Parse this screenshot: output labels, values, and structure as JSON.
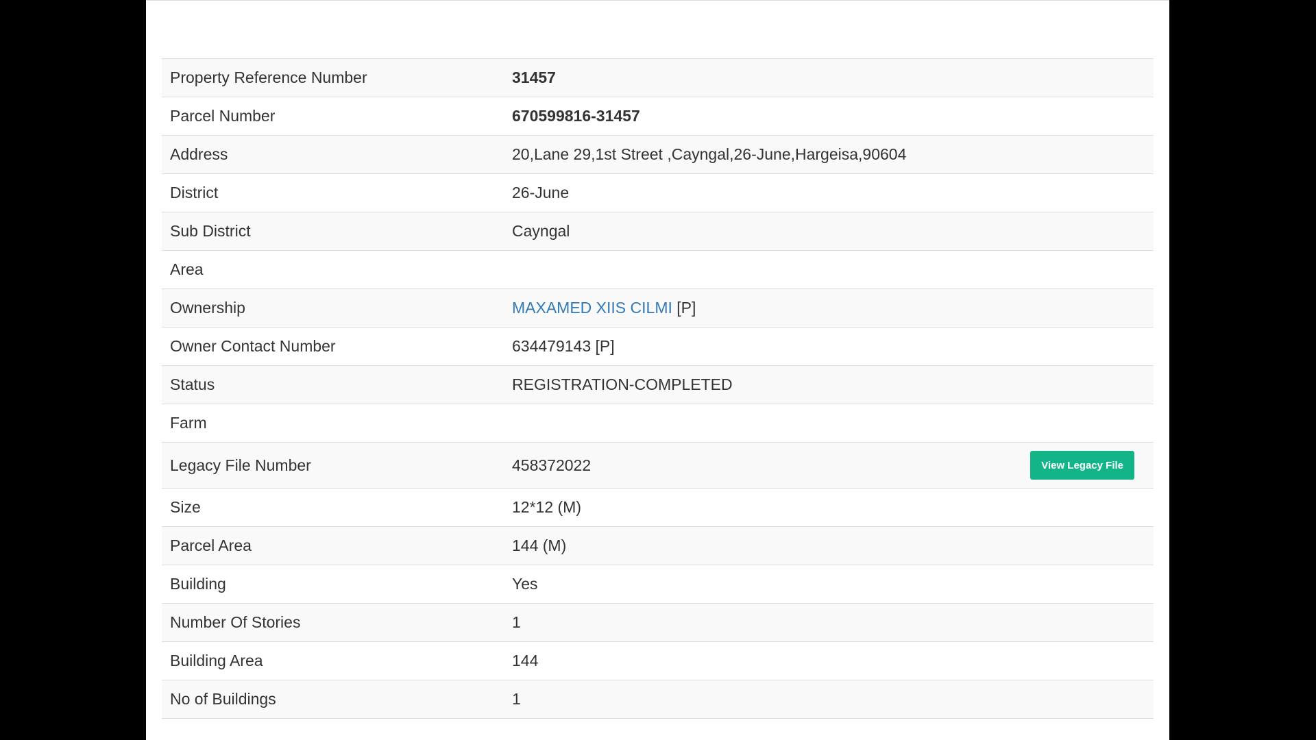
{
  "rows": [
    {
      "label": "Property Reference Number",
      "value": "31457"
    },
    {
      "label": "Parcel Number",
      "value": "670599816-31457"
    },
    {
      "label": "Address",
      "value": "20,Lane 29,1st Street ,Cayngal,26-June,Hargeisa,90604"
    },
    {
      "label": "District",
      "value": "26-June"
    },
    {
      "label": "Sub District",
      "value": "Cayngal"
    },
    {
      "label": "Area",
      "value": ""
    },
    {
      "label": "Ownership",
      "value": "MAXAMED XIIS CILMI",
      "suffix": "[P]"
    },
    {
      "label": "Owner Contact Number",
      "value": "634479143 [P]"
    },
    {
      "label": "Status",
      "value": "REGISTRATION-COMPLETED"
    },
    {
      "label": "Farm",
      "value": ""
    },
    {
      "label": "Legacy File Number",
      "value": "458372022",
      "button": "View Legacy File"
    },
    {
      "label": "Size",
      "value": "12*12 (M)"
    },
    {
      "label": "Parcel Area",
      "value": "144 (M)"
    },
    {
      "label": "Building",
      "value": "Yes"
    },
    {
      "label": "Number Of Stories",
      "value": "1"
    },
    {
      "label": "Building Area",
      "value": "144"
    },
    {
      "label": "No of Buildings",
      "value": "1"
    }
  ],
  "colors": {
    "link": "#337ab7",
    "button": "#14b489",
    "stripe": "#f9f9f9",
    "border": "#dddddd"
  }
}
